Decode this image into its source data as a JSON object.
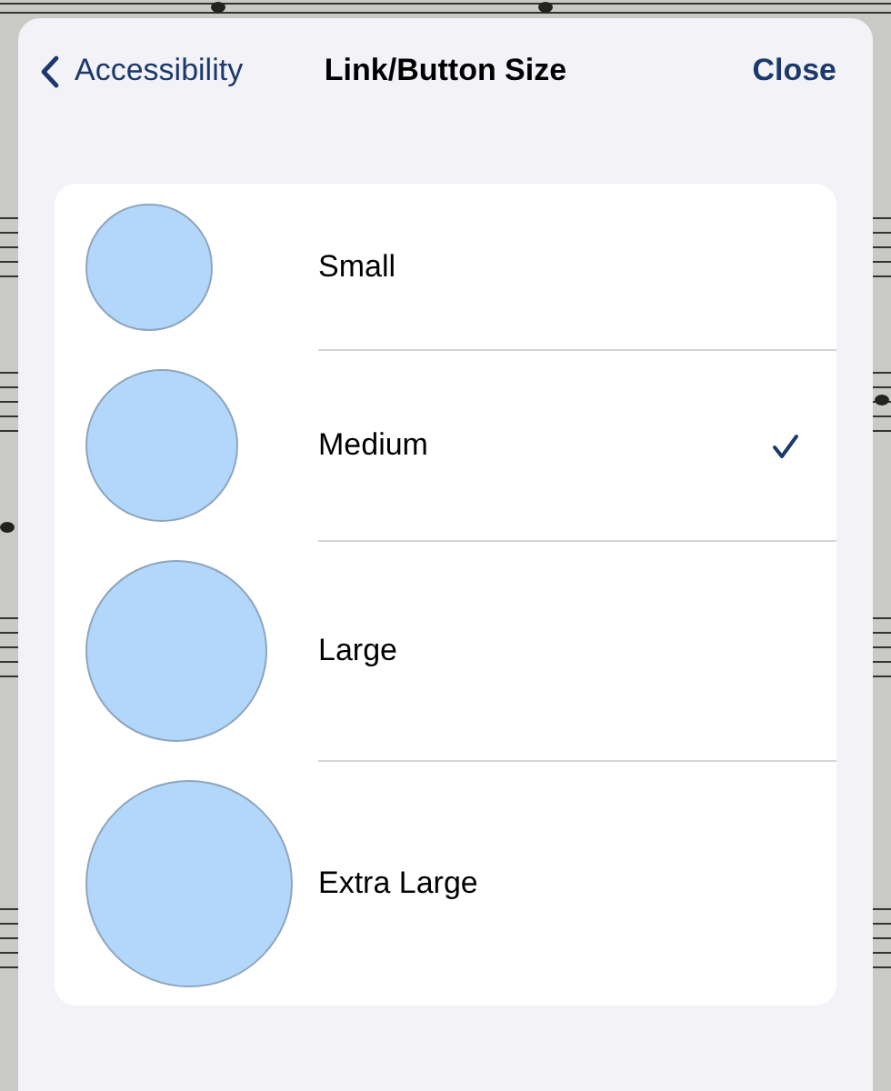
{
  "navigation": {
    "back_label": "Accessibility",
    "title": "Link/Button Size",
    "close_label": "Close"
  },
  "options": [
    {
      "label": "Small",
      "selected": false
    },
    {
      "label": "Medium",
      "selected": true
    },
    {
      "label": "Large",
      "selected": false
    },
    {
      "label": "Extra Large",
      "selected": false
    }
  ]
}
